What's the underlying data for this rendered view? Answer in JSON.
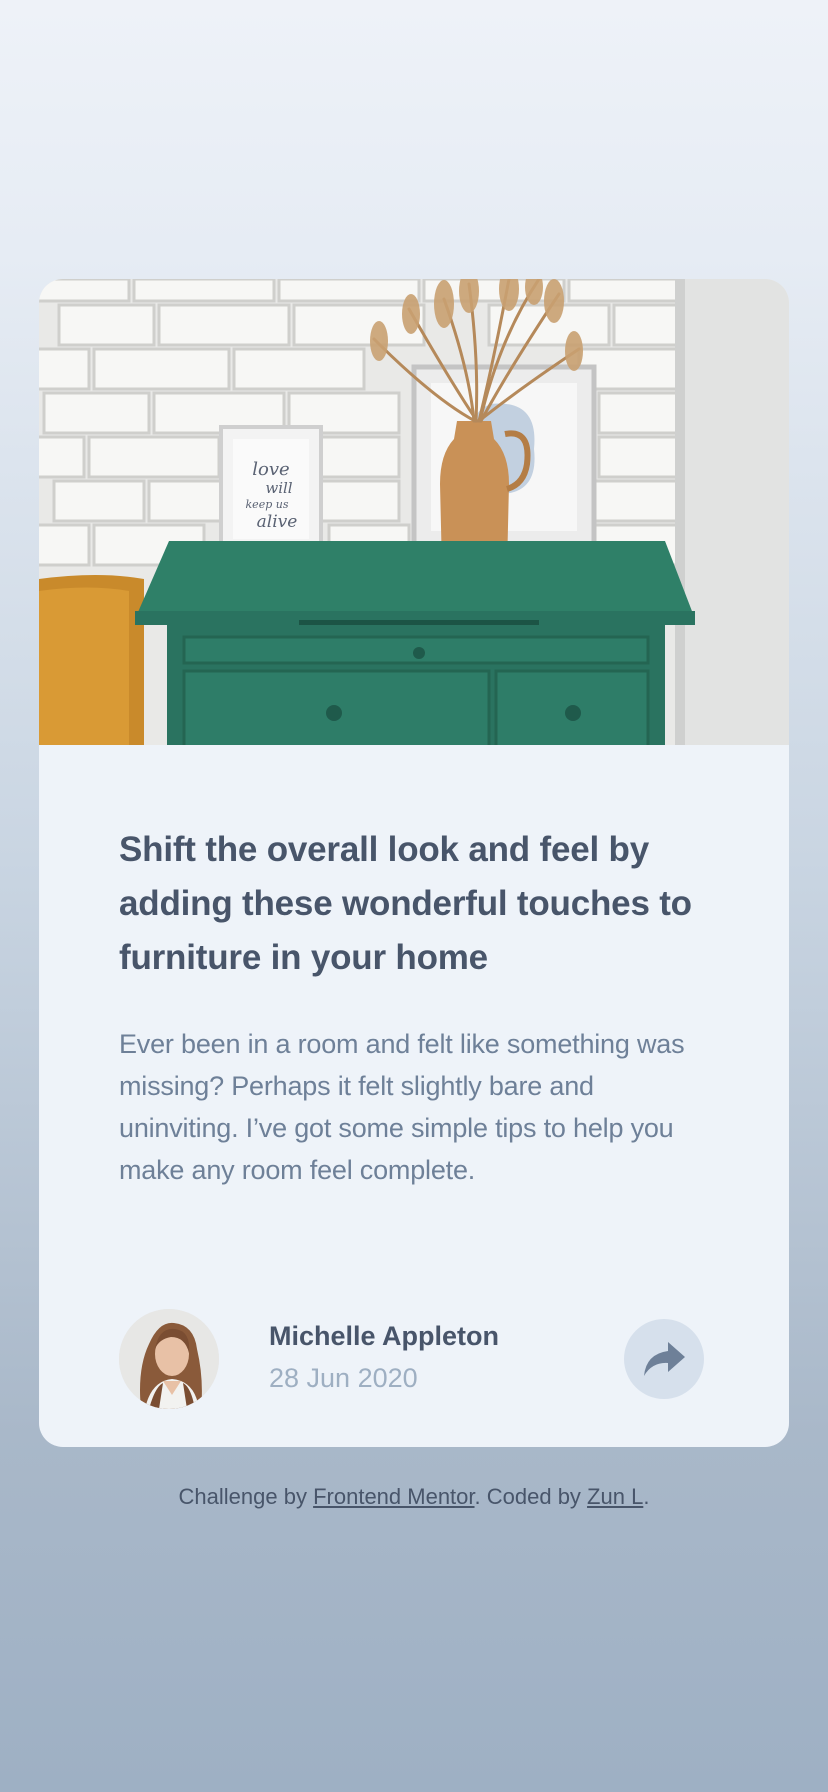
{
  "article": {
    "image_alt": "Green drawer cabinet with framed prints and vase",
    "framed_print_text": "love will keep us alive",
    "title": "Shift the overall look and feel by adding these wonderful touches to furniture in your home",
    "description": "Ever been in a room and felt like something was missing? Perhaps it felt slightly bare and uninviting. I’ve got some simple tips to help you make any room feel complete."
  },
  "author": {
    "name": "Michelle Appleton",
    "date": "28 Jun 2020"
  },
  "share": {
    "icon": "share-arrow-icon"
  },
  "attribution": {
    "prefix": "Challenge by ",
    "link1": "Frontend Mentor",
    "middle": ". Coded by ",
    "link2": "Zun L",
    "suffix": "."
  },
  "colors": {
    "title": "#48556a",
    "body": "#6e8098",
    "muted": "#9eafc2",
    "card": "#eef3f9",
    "share_bg": "#d6e0ec",
    "drawer_green": "#2c7a66"
  }
}
